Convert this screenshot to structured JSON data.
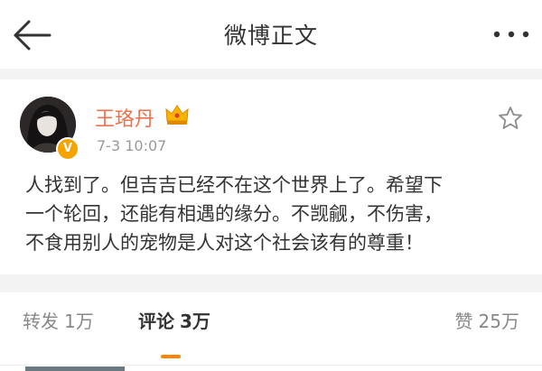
{
  "nav": {
    "title": "微博正文"
  },
  "post": {
    "author": "王珞丹",
    "time": "7-3 10:07",
    "verified_badge": "V",
    "lines": [
      "人找到了。但吉吉已经不在这个世界上了。希望下",
      "一个轮回，还能有相遇的缘分。不觊觎，不伤害，",
      "不食用别人的宠物是人对这个社会该有的尊重！"
    ]
  },
  "tabs": {
    "repost": {
      "label": "转发",
      "count": "1万"
    },
    "comment": {
      "label": "评论",
      "count": "3万"
    },
    "like": {
      "label": "赞",
      "count": "25万"
    }
  },
  "icons": {
    "back": "back-arrow-icon",
    "more": "more-dots-icon",
    "crown": "crown-icon",
    "star": "star-icon",
    "verified": "verified-v-icon"
  },
  "colors": {
    "username": "#eb7350",
    "accent": "#ff8200",
    "badge": "#f5a300",
    "muted": "#9a9a9a",
    "divider": "#f3f3f3"
  }
}
